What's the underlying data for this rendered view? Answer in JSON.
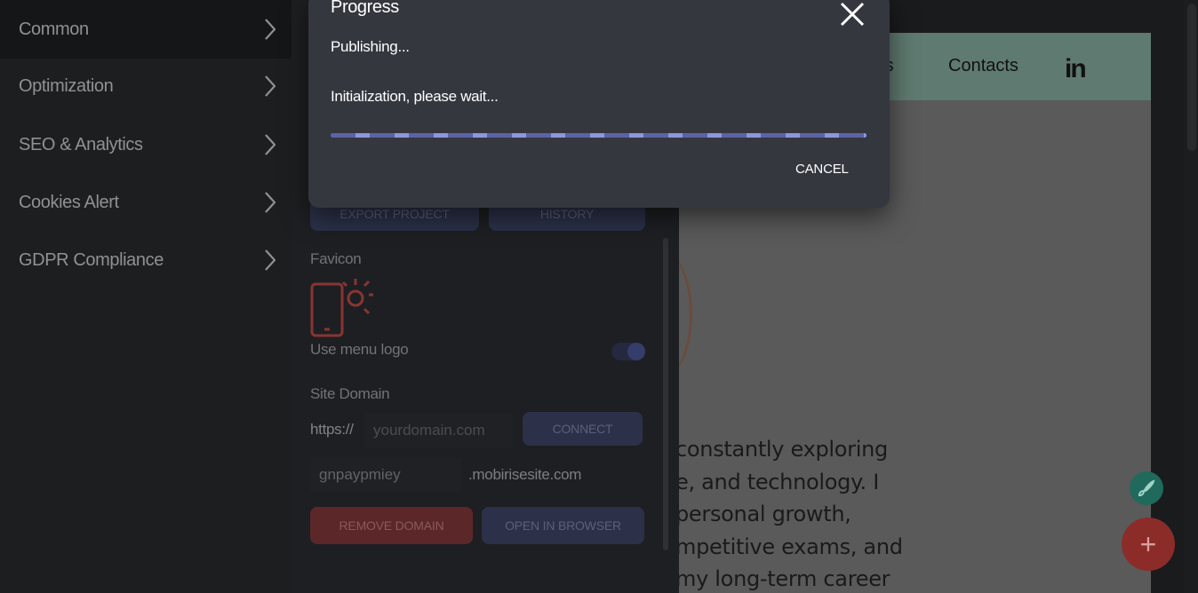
{
  "menu": {
    "items": [
      {
        "label": "Common"
      },
      {
        "label": "Optimization"
      },
      {
        "label": "SEO & Analytics"
      },
      {
        "label": "Cookies Alert"
      },
      {
        "label": "GDPR Compliance"
      }
    ]
  },
  "panel": {
    "export_label": "EXPORT PROJECT",
    "history_label": "HISTORY",
    "favicon_label": "Favicon",
    "use_menu_logo_label": "Use menu logo",
    "use_menu_logo_on": true,
    "site_domain_label": "Site Domain",
    "protocol_prefix": "https://",
    "domain_placeholder": "yourdomain.com",
    "connect_label": "CONNECT",
    "subdomain_value": "gnpaypmiey",
    "subdomain_suffix": ".mobirisesite.com",
    "remove_domain_label": "REMOVE DOMAIN",
    "open_browser_label": "OPEN IN BROWSER"
  },
  "preview": {
    "nav_partial": "ts",
    "nav_contacts": "Contacts",
    "linkedin_text": "in",
    "body_lines": [
      "constantly exploring",
      "e, and technology. I",
      "personal growth,",
      "mpetitive exams, and",
      "my long-term career"
    ]
  },
  "dialog": {
    "title": "Progress",
    "status_primary": "Publishing...",
    "status_secondary": "Initialization, please wait...",
    "cancel_label": "CANCEL"
  },
  "fab": {
    "add_symbol": "+"
  },
  "colors": {
    "accent": "#6a73b8",
    "danger": "#8f2f2d",
    "dialog_bg": "#35373f"
  }
}
